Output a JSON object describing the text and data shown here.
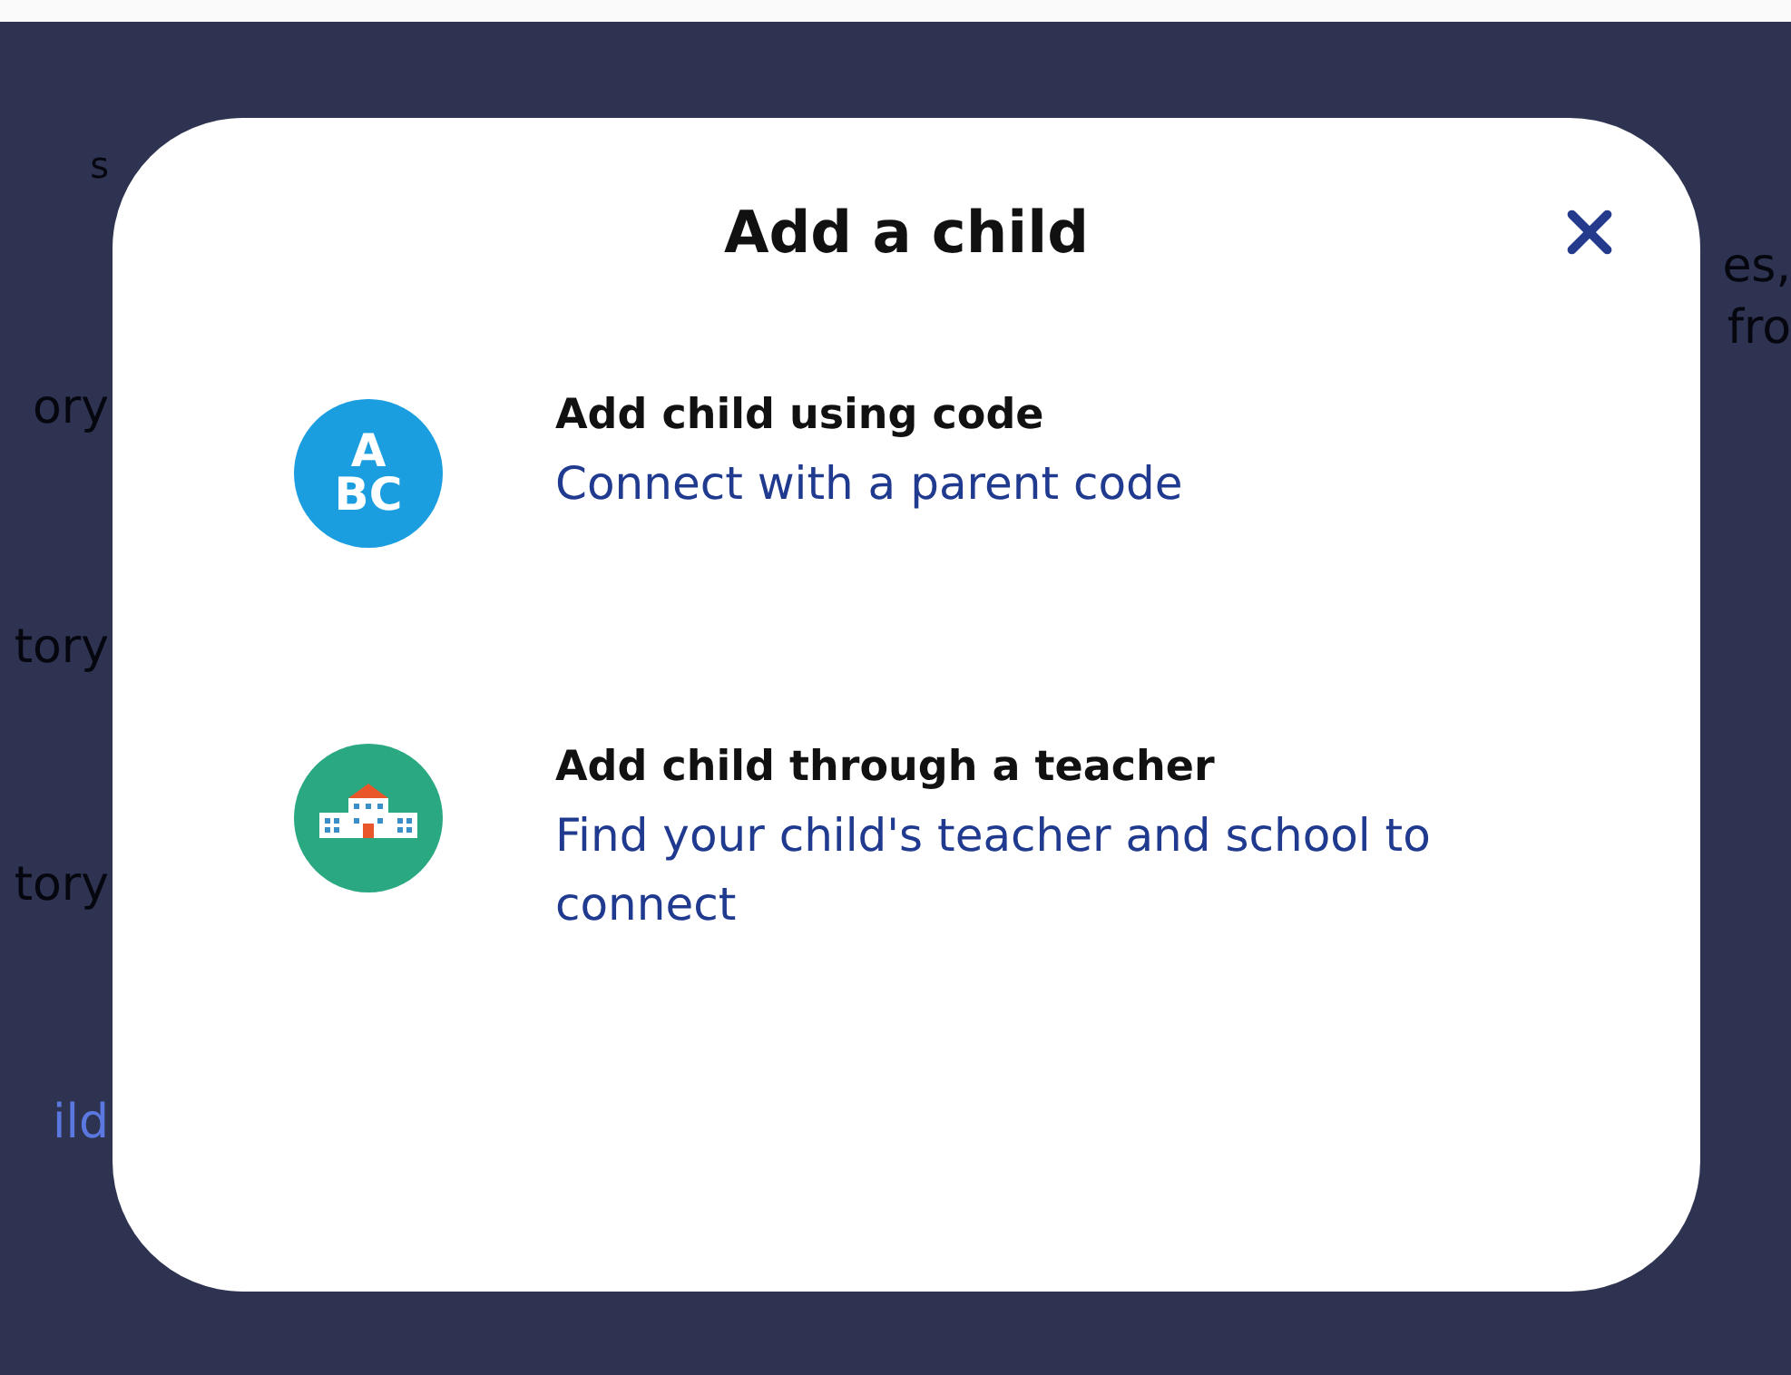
{
  "background": {
    "left_texts": [
      {
        "text": "s",
        "kind": "plain"
      },
      {
        "text": "ory",
        "kind": "plain"
      },
      {
        "text": "tory",
        "kind": "plain"
      },
      {
        "text": "tory",
        "kind": "plain"
      },
      {
        "text": "ild",
        "kind": "link"
      }
    ],
    "right_texts": [
      "es,",
      "fro"
    ]
  },
  "modal": {
    "title": "Add a child",
    "options": [
      {
        "kind": "code",
        "icon_letters": [
          "A",
          "BC"
        ],
        "title": "Add child using code",
        "subtitle": "Connect with a parent code"
      },
      {
        "kind": "teacher",
        "title": "Add child through a teacher",
        "subtitle": "Find your child's teacher and school to connect"
      }
    ]
  }
}
